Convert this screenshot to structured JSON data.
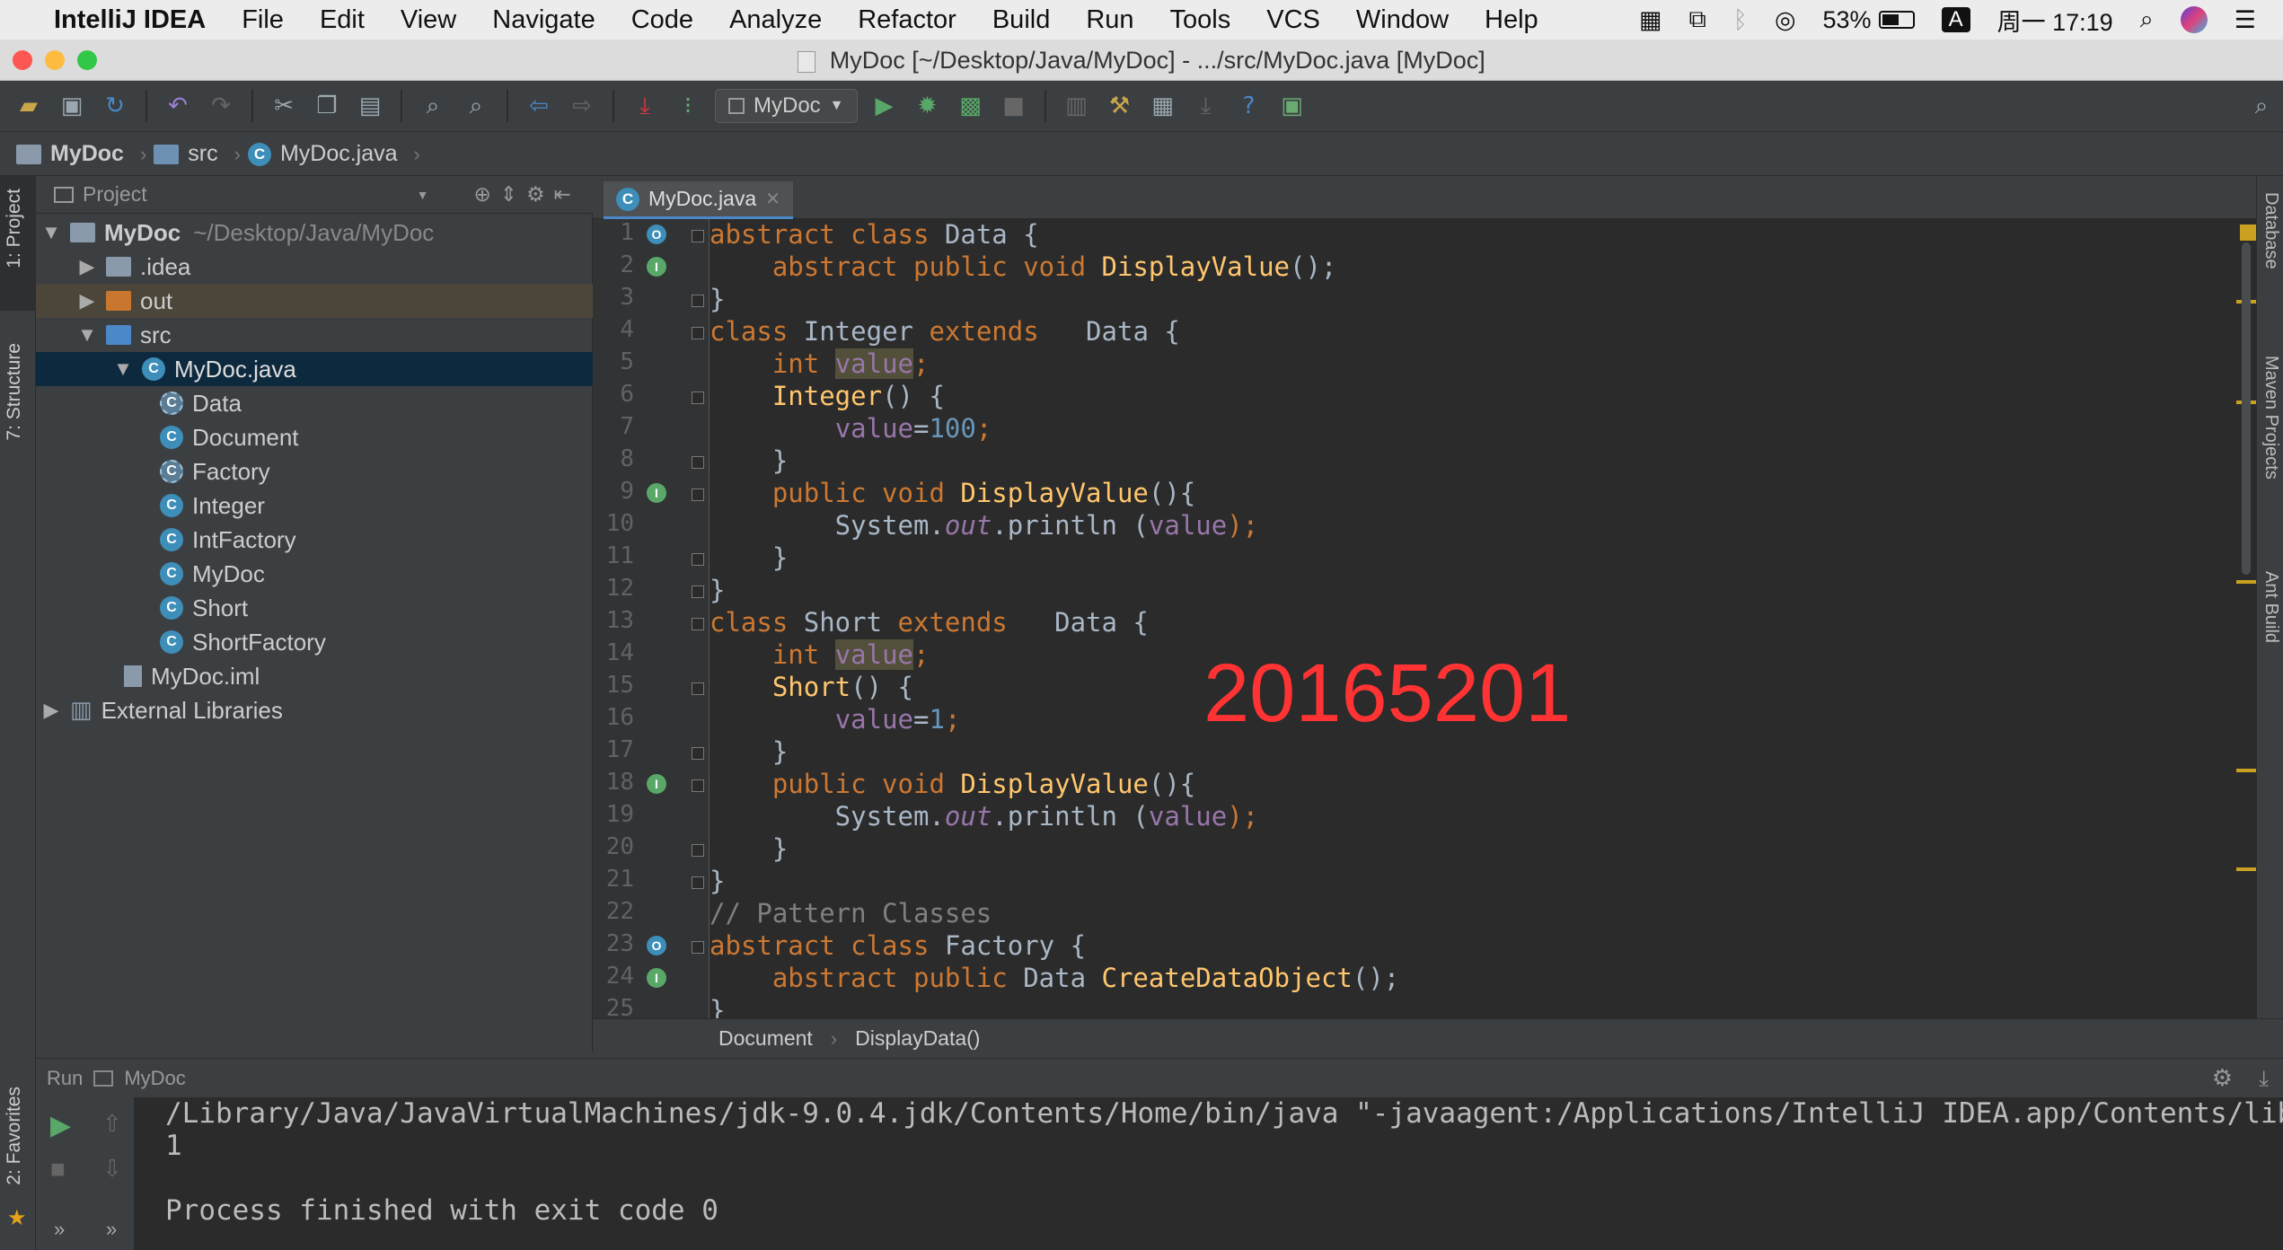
{
  "menubar": {
    "app": "IntelliJ IDEA",
    "items": [
      "File",
      "Edit",
      "View",
      "Navigate",
      "Code",
      "Analyze",
      "Refactor",
      "Build",
      "Run",
      "Tools",
      "VCS",
      "Window",
      "Help"
    ],
    "battery": "53%",
    "input_method": "A",
    "clock": "周一 17:19"
  },
  "window_title": "MyDoc [~/Desktop/Java/MyDoc] - .../src/MyDoc.java [MyDoc]",
  "toolbar": {
    "run_config": "MyDoc"
  },
  "breadcrumbs": [
    "MyDoc",
    "src",
    "MyDoc.java"
  ],
  "left_tabs": [
    "1: Project",
    "7: Structure",
    "2: Favorites"
  ],
  "project_panel": {
    "title": "Project",
    "tree": [
      {
        "label": "MyDoc",
        "path": "~/Desktop/Java/MyDoc"
      },
      {
        "label": ".idea"
      },
      {
        "label": "out"
      },
      {
        "label": "src"
      },
      {
        "label": "MyDoc.java"
      },
      {
        "label": "Data"
      },
      {
        "label": "Document"
      },
      {
        "label": "Factory"
      },
      {
        "label": "Integer"
      },
      {
        "label": "IntFactory"
      },
      {
        "label": "MyDoc"
      },
      {
        "label": "Short"
      },
      {
        "label": "ShortFactory"
      },
      {
        "label": "MyDoc.iml"
      },
      {
        "label": "External Libraries"
      }
    ]
  },
  "editor": {
    "tab": "MyDoc.java",
    "line_numbers": [
      "1",
      "2",
      "3",
      "4",
      "5",
      "6",
      "7",
      "8",
      "9",
      "10",
      "11",
      "12",
      "13",
      "14",
      "15",
      "16",
      "17",
      "18",
      "19",
      "20",
      "21",
      "22",
      "23",
      "24",
      "25"
    ],
    "code": {
      "l1": [
        "abstract class ",
        "Data {"
      ],
      "l2": [
        "    ",
        "abstract public void ",
        "DisplayValue",
        "();"
      ],
      "l3": [
        "}"
      ],
      "l4": [
        "class ",
        "Integer ",
        "extends ",
        "  Data {"
      ],
      "l5": [
        "    ",
        "int ",
        "value",
        ";"
      ],
      "l6": [
        "    ",
        "Integer",
        "() {"
      ],
      "l7": [
        "        ",
        "value",
        "=",
        "100",
        ";"
      ],
      "l8": [
        "    }"
      ],
      "l9": [
        "    ",
        "public void ",
        "DisplayValue",
        "(){"
      ],
      "l10": [
        "        System.",
        "out",
        ".println (",
        "value",
        ");"
      ],
      "l11": [
        "    }"
      ],
      "l12": [
        "}"
      ],
      "l13": [
        "class ",
        "Short ",
        "extends ",
        "  Data {"
      ],
      "l14": [
        "    ",
        "int ",
        "value",
        ";"
      ],
      "l15": [
        "    ",
        "Short",
        "() {"
      ],
      "l16": [
        "        ",
        "value",
        "=",
        "1",
        ";"
      ],
      "l17": [
        "    }"
      ],
      "l18": [
        "    ",
        "public void ",
        "DisplayValue",
        "(){"
      ],
      "l19": [
        "        System.",
        "out",
        ".println (",
        "value",
        ");"
      ],
      "l20": [
        "    }"
      ],
      "l21": [
        "}"
      ],
      "l22": [
        "// Pattern Classes"
      ],
      "l23": [
        "abstract class ",
        "Factory {"
      ],
      "l24": [
        "    ",
        "abstract public ",
        "Data ",
        "CreateDataObject",
        "();"
      ],
      "l25": [
        "}"
      ]
    },
    "breadcrumbs": [
      "Document",
      "DisplayData()"
    ],
    "watermark": "20165201"
  },
  "right_tabs": [
    "Database",
    "Maven Projects",
    "Ant Build"
  ],
  "run_panel": {
    "label": "Run",
    "config": "MyDoc",
    "output": [
      "/Library/Java/JavaVirtualMachines/jdk-9.0.4.jdk/Contents/Home/bin/java \"-javaagent:/Applications/IntelliJ IDEA.app/Contents/lib/id",
      "1",
      "",
      "Process finished with exit code 0"
    ]
  }
}
